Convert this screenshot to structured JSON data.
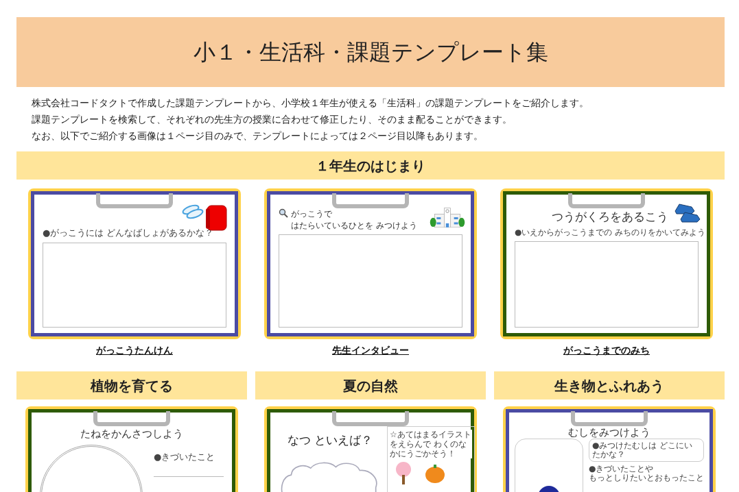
{
  "header": {
    "title": "小１・生活科・課題テンプレート集"
  },
  "intro": [
    "株式会社コードタクトで作成した課題テンプレートから、小学校１年生が使える「生活科」の課題テンプレートをご紹介します。",
    "課題テンプレートを検索して、それぞれの先生方の授業に合わせて修正したり、そのまま配ることができます。",
    "なお、以下でご紹介する画像は１ページ目のみで、テンプレートによっては２ページ目以降もあります。"
  ],
  "sections": [
    {
      "kind": "wide",
      "title": "１年生のはじまり",
      "templates": [
        {
          "kind": "box",
          "color": "#4b4ba3",
          "lines": [
            "●がっこうには どんなばしょがあるかな？"
          ],
          "caption": "がっこうたんけん"
        },
        {
          "kind": "box",
          "color": "#4b4ba3",
          "lines": [
            "がっこうで",
            "はたらいているひとを みつけよう"
          ],
          "caption": "先生インタビュー"
        },
        {
          "kind": "box",
          "color": "#2e5b06",
          "title": "つうがくろをあるこう",
          "lines": [
            "●いえからがっこうまでの みちのりをかいてみよう"
          ],
          "caption": "がっこうまでのみち"
        }
      ]
    },
    {
      "kind": "column",
      "title": "植物を育てる",
      "templates": [
        {
          "kind": "circle",
          "color": "#2e5b06",
          "title": "たねをかんさつしよう",
          "lines": [
            "●きづいたこと"
          ]
        }
      ]
    },
    {
      "kind": "column",
      "title": "夏の自然",
      "templates": [
        {
          "kind": "cloud",
          "color": "#2e5b06",
          "title": "なつ といえば？",
          "lines": [
            "☆あてはまるイラストをえらんで",
            "わくのなかにうごかそう！"
          ]
        }
      ]
    },
    {
      "kind": "column",
      "title": "生き物とふれあう",
      "templates": [
        {
          "kind": "photo",
          "color": "#4b4ba3",
          "title": "むしをみつけよう",
          "lines": [
            "●みつけたむしは どこにいたかな？",
            "●きづいたことや",
            "もっとしりたいとおもったこと"
          ]
        }
      ]
    }
  ]
}
